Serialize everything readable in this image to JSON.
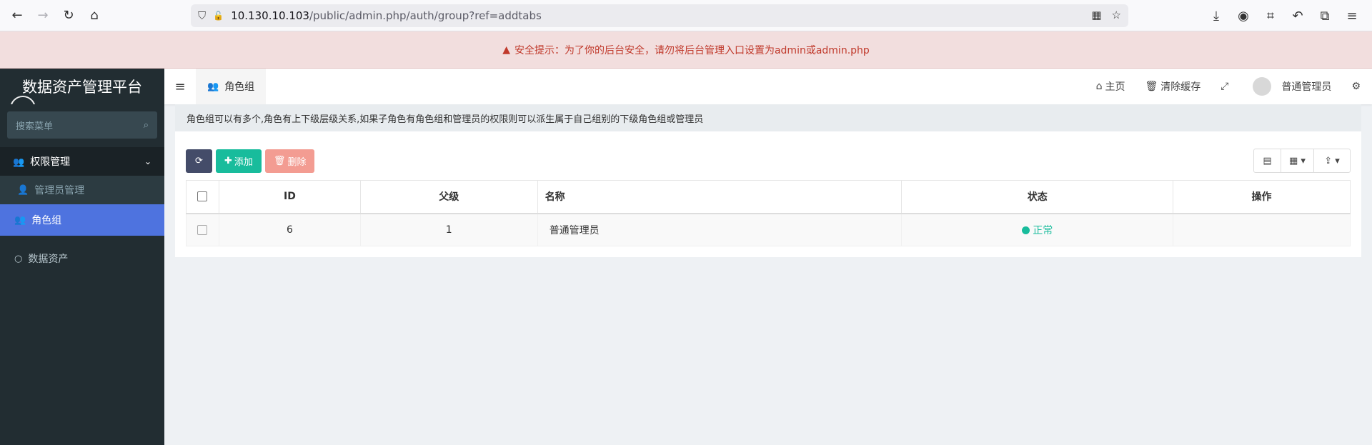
{
  "browser": {
    "url_host": "10.130.10.103",
    "url_path": "/public/admin.php/auth/group?ref=addtabs"
  },
  "warning": {
    "text": "安全提示：为了你的后台安全，请勿将后台管理入口设置为admin或admin.php"
  },
  "sidebar": {
    "brand": "数据资产管理平台",
    "search_placeholder": "搜索菜单",
    "group_label": "权限管理",
    "items": [
      {
        "label": "管理员管理"
      },
      {
        "label": "角色组"
      },
      {
        "label": "数据资产"
      }
    ]
  },
  "header": {
    "tab_label": "角色组",
    "home": "主页",
    "clear_cache": "清除缓存",
    "user": "普通管理员"
  },
  "content": {
    "tip": "角色组可以有多个,角色有上下级层级关系,如果子角色有角色组和管理员的权限则可以派生属于自己组别的下级角色组或管理员",
    "add_label": "添加",
    "delete_label": "删除",
    "columns": [
      "ID",
      "父级",
      "名称",
      "状态",
      "操作"
    ],
    "rows": [
      {
        "id": "6",
        "parent": "1",
        "name": "普通管理员",
        "status": "正常"
      }
    ]
  },
  "colors": {
    "accent": "#4e73df",
    "success": "#18bc9c",
    "danger_soft": "#f39c92",
    "sidebar_bg": "#222d32"
  }
}
